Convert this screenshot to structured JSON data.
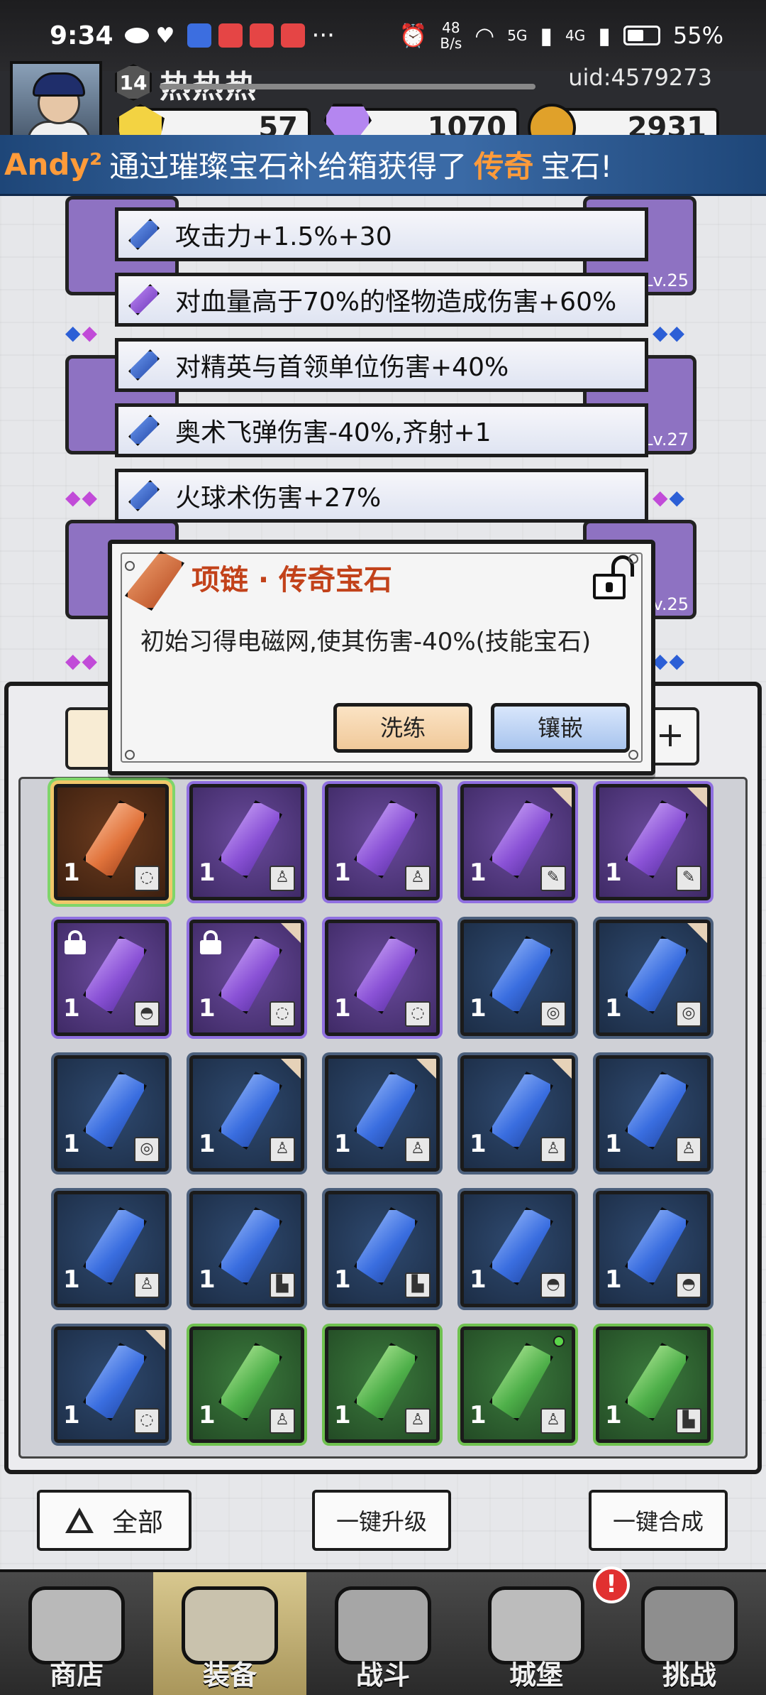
{
  "status_bar": {
    "time": "9:34",
    "net_speed_value": "48",
    "net_speed_unit": "B/s",
    "signal_1": "5G",
    "signal_2": "4G",
    "battery": "55%",
    "battery_level": 0.55,
    "more": "···"
  },
  "profile": {
    "level": "14",
    "name": "热热热",
    "uid": "uid:4579273"
  },
  "currency": {
    "gold": "57",
    "diamond": "1070",
    "coin": "2931"
  },
  "broadcast": {
    "player": "Andy²",
    "text_before": "通过璀璨宝石补给箱获得了",
    "highlight": "传奇",
    "text_after": "宝石!"
  },
  "equipment_levels": [
    "Lv.25",
    "Lv.27",
    "Lv.25"
  ],
  "stats": [
    {
      "text": "攻击力+1.5%+30",
      "color": "blue"
    },
    {
      "text": "对血量高于70%的怪物造成伤害+60%",
      "color": "purple"
    },
    {
      "text": "对精英与首领单位伤害+40%",
      "color": "blue"
    },
    {
      "text": "奥术飞弹伤害-40%,齐射+1",
      "color": "blue"
    },
    {
      "text": "火球术伤害+27%",
      "color": "blue"
    }
  ],
  "popup": {
    "title": "项链 · 传奇宝石",
    "description": "初始习得电磁网,使其伤害-40%(技能宝石)",
    "wash_button": "洗练",
    "inlay_button": "镶嵌"
  },
  "inventory": {
    "plus_label": "+",
    "rows": [
      [
        {
          "rarity": "orange",
          "qty": "1",
          "type": "necklace-icon"
        },
        {
          "rarity": "purple",
          "qty": "1",
          "type": "armor-icon"
        },
        {
          "rarity": "purple",
          "qty": "1",
          "type": "armor-icon"
        },
        {
          "rarity": "purple",
          "qty": "1",
          "type": "weapon-icon",
          "corner": true
        },
        {
          "rarity": "purple",
          "qty": "1",
          "type": "weapon-icon",
          "corner": true
        }
      ],
      [
        {
          "rarity": "purple",
          "qty": "1",
          "type": "helmet-icon",
          "locked": true
        },
        {
          "rarity": "purple",
          "qty": "1",
          "type": "necklace-icon",
          "locked": true,
          "corner": true
        },
        {
          "rarity": "purple",
          "qty": "1",
          "type": "necklace-icon"
        },
        {
          "rarity": "blue",
          "qty": "1",
          "type": "ring-icon"
        },
        {
          "rarity": "blue",
          "qty": "1",
          "type": "ring-icon",
          "corner": true
        }
      ],
      [
        {
          "rarity": "blue",
          "qty": "1",
          "type": "ring-icon"
        },
        {
          "rarity": "blue",
          "qty": "1",
          "type": "armor-icon",
          "corner": true
        },
        {
          "rarity": "blue",
          "qty": "1",
          "type": "armor-icon",
          "corner": true
        },
        {
          "rarity": "blue",
          "qty": "1",
          "type": "armor-icon",
          "corner": true
        },
        {
          "rarity": "blue",
          "qty": "1",
          "type": "armor-icon"
        }
      ],
      [
        {
          "rarity": "blue",
          "qty": "1",
          "type": "armor-icon"
        },
        {
          "rarity": "blue",
          "qty": "1",
          "type": "boots-icon"
        },
        {
          "rarity": "blue",
          "qty": "1",
          "type": "boots-icon"
        },
        {
          "rarity": "blue",
          "qty": "1",
          "type": "helmet-icon"
        },
        {
          "rarity": "blue",
          "qty": "1",
          "type": "helmet-icon"
        }
      ],
      [
        {
          "rarity": "blue",
          "qty": "1",
          "type": "necklace-icon",
          "corner": true
        },
        {
          "rarity": "green",
          "qty": "1",
          "type": "armor-icon"
        },
        {
          "rarity": "green",
          "qty": "1",
          "type": "armor-icon"
        },
        {
          "rarity": "green",
          "qty": "1",
          "type": "armor-icon",
          "new": true
        },
        {
          "rarity": "green",
          "qty": "1",
          "type": "boots-icon"
        }
      ]
    ]
  },
  "buttons": {
    "all": "全部",
    "upgrade_all": "一键升级",
    "merge_all": "一键合成"
  },
  "nav": {
    "items": [
      {
        "label": "商店",
        "icon": "shop-icon"
      },
      {
        "label": "装备",
        "icon": "backpack-icon",
        "active": true
      },
      {
        "label": "战斗",
        "icon": "swords-icon"
      },
      {
        "label": "城堡",
        "icon": "castle-icon"
      },
      {
        "label": "挑战",
        "icon": "challenge-icon"
      }
    ],
    "alert": "!"
  }
}
